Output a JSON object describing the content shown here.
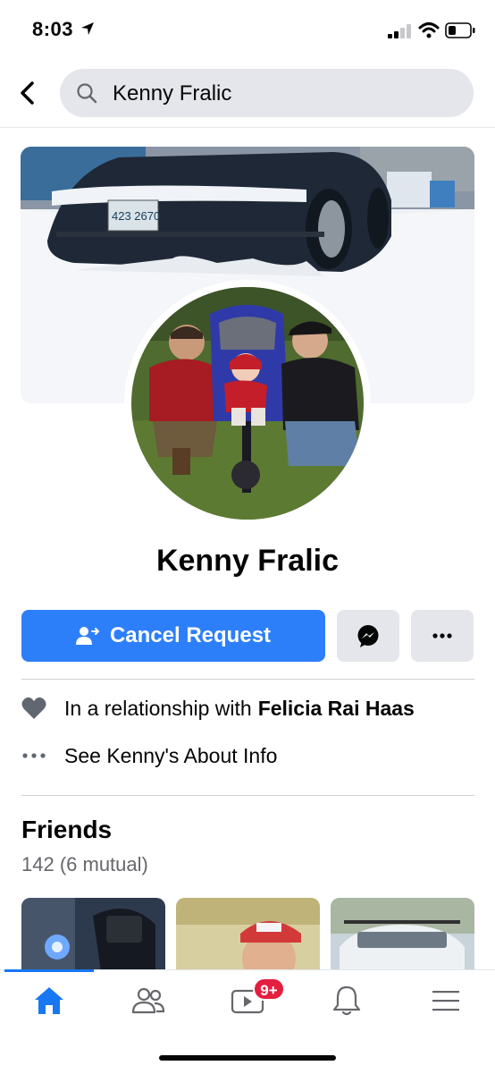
{
  "status": {
    "time": "8:03"
  },
  "search": {
    "query": "Kenny Fralic"
  },
  "profile": {
    "name": "Kenny Fralic",
    "cover_plate_text": "423 2670"
  },
  "actions": {
    "cancel_request_label": "Cancel Request"
  },
  "info": {
    "relationship_prefix": "In a relationship with",
    "relationship_partner": "Felicia Rai Haas",
    "about_label": "See Kenny's About Info"
  },
  "friends": {
    "title": "Friends",
    "count": "142 (6 mutual)"
  },
  "tabbar": {
    "watch_badge": "9+",
    "active_tab": "home"
  },
  "colors": {
    "accent": "#1877f2",
    "primary_button": "#2d7ff9",
    "gray_button": "#e4e6eb",
    "badge": "#e41e3f",
    "secondary_text": "#65676b"
  },
  "icons": [
    "location-arrow-icon",
    "signal-icon",
    "wifi-icon",
    "battery-icon",
    "back-icon",
    "search-icon",
    "add-friend-icon",
    "messenger-icon",
    "more-icon",
    "heart-icon",
    "ellipsis-icon",
    "home-icon",
    "friends-icon",
    "watch-icon",
    "bell-icon",
    "menu-icon"
  ]
}
